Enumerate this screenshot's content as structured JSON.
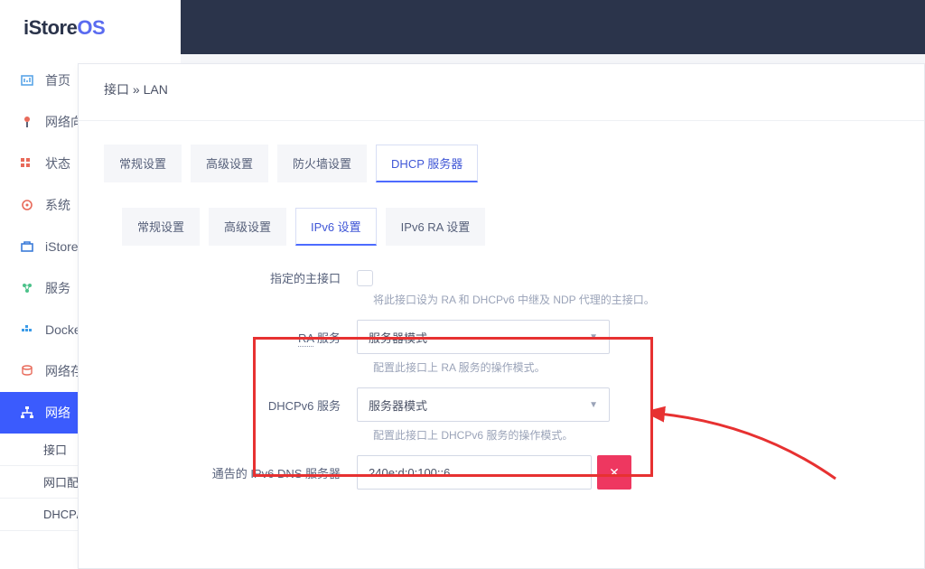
{
  "logo": {
    "pre": "iStore",
    "accent": "OS"
  },
  "sidebar": {
    "items": [
      {
        "label": "首页",
        "icon": "home"
      },
      {
        "label": "网络向导",
        "icon": "wizard"
      },
      {
        "label": "状态",
        "icon": "status"
      },
      {
        "label": "系统",
        "icon": "gear"
      },
      {
        "label": "iStore",
        "icon": "store"
      },
      {
        "label": "服务",
        "icon": "services"
      },
      {
        "label": "Docker",
        "icon": "docker"
      },
      {
        "label": "网络存储",
        "icon": "storage"
      },
      {
        "label": "网络",
        "icon": "network"
      }
    ],
    "subs": [
      "接口",
      "网口配置",
      "DHCP/DNS"
    ]
  },
  "modal": {
    "breadcrumb": "接口 » LAN",
    "tabs1": [
      "常规设置",
      "高级设置",
      "防火墙设置",
      "DHCP 服务器"
    ],
    "tabs1_active": 3,
    "tabs2": [
      "常规设置",
      "高级设置",
      "IPv6 设置",
      "IPv6 RA 设置"
    ],
    "tabs2_active": 2
  },
  "form": {
    "master": {
      "label": "指定的主接口",
      "help": "将此接口设为 RA 和 DHCPv6 中继及 NDP 代理的主接口。"
    },
    "ra": {
      "label_u": "RA",
      "label_r": " 服务",
      "value": "服务器模式",
      "help": "配置此接口上 RA 服务的操作模式。"
    },
    "dhcpv6": {
      "label": "DHCPv6 服务",
      "value": "服务器模式",
      "help": "配置此接口上 DHCPv6 服务的操作模式。"
    },
    "dns": {
      "label": "通告的 IPv6 DNS 服务器",
      "value": "240e:d:0:100::6"
    }
  }
}
